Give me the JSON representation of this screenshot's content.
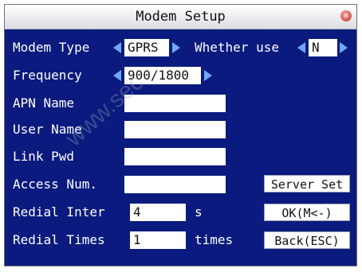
{
  "window": {
    "title": "Modem Setup"
  },
  "icons": {
    "close": "close-icon"
  },
  "fields": {
    "modem_type": {
      "label": "Modem Type",
      "value": "GPRS"
    },
    "whether_use": {
      "label": "Whether use",
      "value": "N"
    },
    "frequency": {
      "label": "Frequency",
      "value": "900/1800"
    },
    "apn_name": {
      "label": "APN Name",
      "value": ""
    },
    "user_name": {
      "label": "User Name",
      "value": ""
    },
    "link_pwd": {
      "label": "Link Pwd",
      "value": ""
    },
    "access_num": {
      "label": "Access Num.",
      "value": ""
    },
    "redial_inter": {
      "label": "Redial Inter",
      "value": "4",
      "unit": "s"
    },
    "redial_times": {
      "label": "Redial Times",
      "value": "1",
      "unit": "times"
    }
  },
  "buttons": {
    "server_set": "Server Set",
    "ok": "OK(M<-)",
    "back": "Back(ESC)"
  },
  "watermark": "www.sec"
}
